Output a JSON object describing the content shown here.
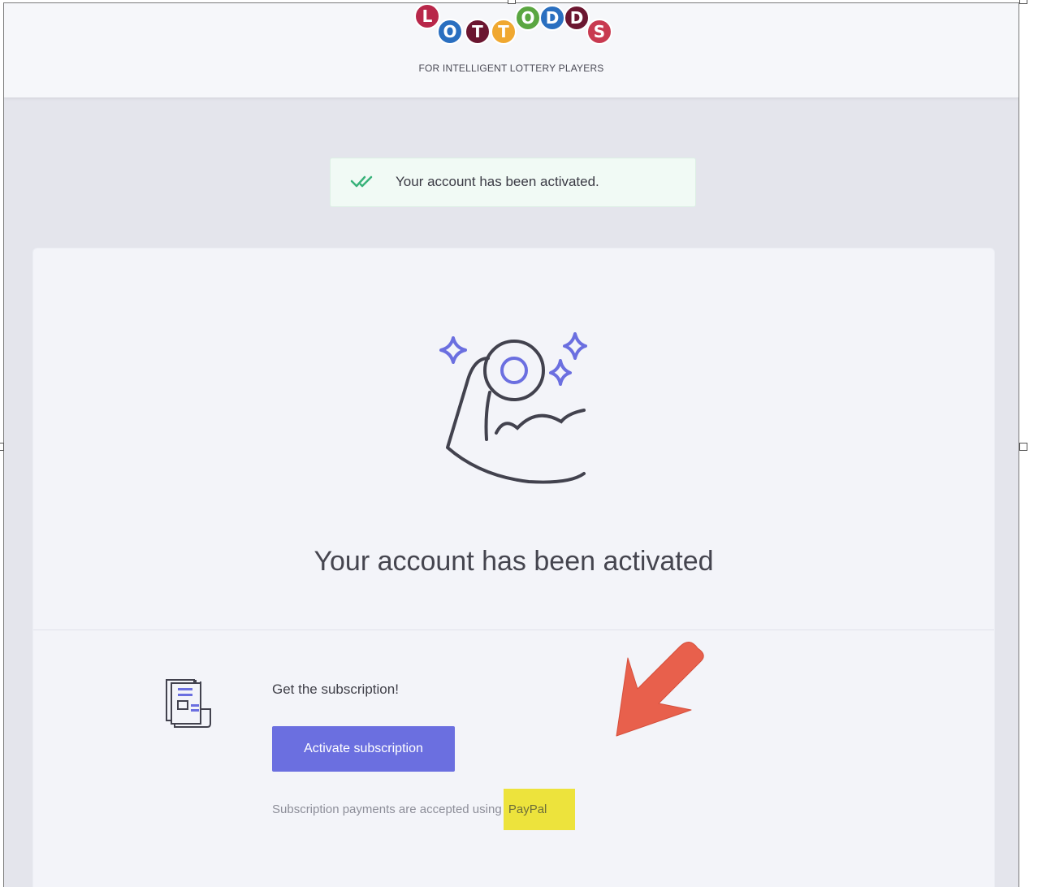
{
  "logo": {
    "balls": [
      {
        "letter": "L",
        "color": "#b8274a"
      },
      {
        "letter": "O",
        "color": "#2a6fc0"
      },
      {
        "letter": "T",
        "color": "#6b1630"
      },
      {
        "letter": "T",
        "color": "#f0a830"
      },
      {
        "letter": "O",
        "color": "#5aa641"
      },
      {
        "letter": "D",
        "color": "#2a6fc0"
      },
      {
        "letter": "D",
        "color": "#6b1630"
      },
      {
        "letter": "S",
        "color": "#c83a50"
      }
    ],
    "tagline": "FOR INTELLIGENT LOTTERY PLAYERS"
  },
  "alert": {
    "message": "Your account has been activated.",
    "icon": "double-check-icon",
    "color": "#39b27a"
  },
  "card": {
    "hero_icon": "strong-arm-icon",
    "headline": "Your account has been activated"
  },
  "subscription": {
    "icon": "newspaper-icon",
    "heading": "Get the subscription!",
    "button_label": "Activate subscription",
    "note_prefix": "Subscription payments are accepted using",
    "note_highlight": "PayPal"
  },
  "annotation": {
    "arrow_icon": "arrow-pointer-icon",
    "arrow_color": "#e8604c",
    "highlight_color": "#ede33c"
  },
  "theme": {
    "accent": "#6b6fe0"
  }
}
